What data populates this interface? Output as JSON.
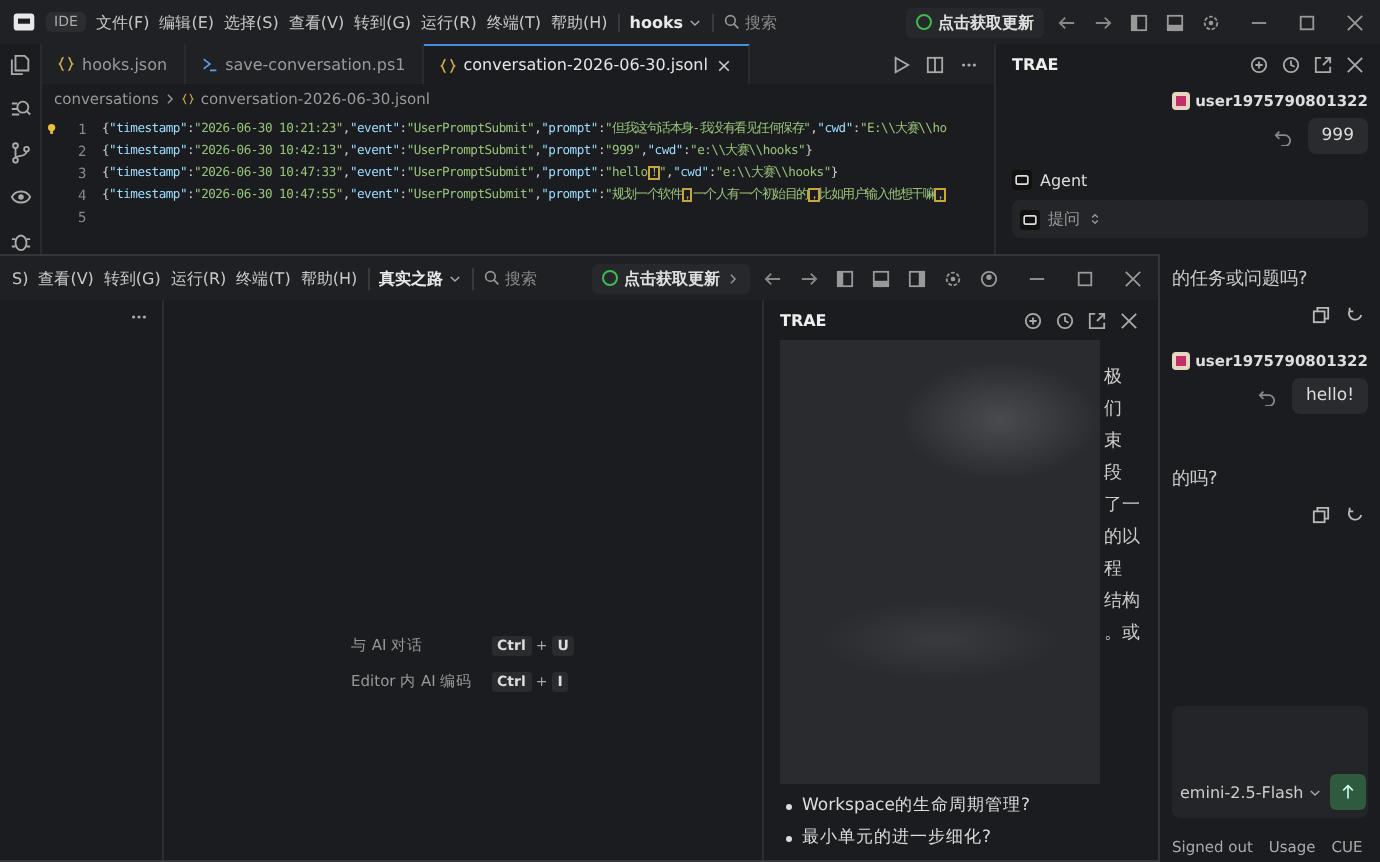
{
  "back_window": {
    "app_label": "IDE",
    "menu": [
      "文件(F)",
      "编辑(E)",
      "选择(S)",
      "查看(V)",
      "转到(G)",
      "运行(R)",
      "终端(T)",
      "帮助(H)"
    ],
    "project": "hooks",
    "search_placeholder": "搜索",
    "update_button": "点击获取更新",
    "tabs": [
      {
        "label": "hooks.json",
        "kind": "json",
        "selected": false
      },
      {
        "label": "save-conversation.ps1",
        "kind": "shell",
        "selected": false
      },
      {
        "label": "conversation-2026-06-30.jsonl",
        "kind": "json",
        "selected": true
      }
    ],
    "breadcrumb": [
      "conversations",
      "conversation-2026-06-30.jsonl"
    ],
    "code_lines": [
      {
        "number": "1",
        "text": "{\"timestamp\":\"2026-06-30 10:21:23\",\"event\":\"UserPromptSubmit\",\"prompt\":\"但我这句话本身-我没有看见任何保存\",\"cwd\":\"E:\\\\大赛\\\\ho"
      },
      {
        "number": "2",
        "text": "{\"timestamp\":\"2026-06-30 10:42:13\",\"event\":\"UserPromptSubmit\",\"prompt\":\"999\",\"cwd\":\"e:\\\\大赛\\\\hooks\"}"
      },
      {
        "number": "3",
        "text": "{\"timestamp\":\"2026-06-30 10:47:33\",\"event\":\"UserPromptSubmit\",\"prompt\":\"hello！\",\"cwd\":\"e:\\\\大赛\\\\hooks\"}"
      },
      {
        "number": "4",
        "text": "{\"timestamp\":\"2026-06-30 10:47:55\",\"event\":\"UserPromptSubmit\",\"prompt\":\"规划一个软件，一个人有一个初始目的，比如用户输入他想干嘛，"
      },
      {
        "number": "5"
      }
    ],
    "chat": {
      "title": "TRAE",
      "user_name": "user1975790801322",
      "first_prompt": "999",
      "agent_label": "Agent",
      "mode_select": "提问",
      "reply_tail": "的任务或问题吗?",
      "second_user_name": "user1975790801322",
      "second_prompt": "hello!",
      "second_reply_tail": "的吗?",
      "model": "emini-2.5-Flash",
      "status": [
        "Signed out",
        "Usage",
        "CUE"
      ]
    }
  },
  "front_window": {
    "menu": [
      "S)",
      "查看(V)",
      "转到(G)",
      "运行(R)",
      "终端(T)",
      "帮助(H)"
    ],
    "project": "真实之路",
    "search_placeholder": "搜索",
    "update_button": "点击获取更新",
    "shortcuts": [
      {
        "label": "与 AI 对话",
        "keys": [
          "Ctrl",
          "U"
        ],
        "separator": "+"
      },
      {
        "label": "Editor 内 AI 编码",
        "keys": [
          "Ctrl",
          "I"
        ],
        "separator": "+"
      }
    ],
    "panel": {
      "title": "TRAE",
      "peek_fragments": [
        "极",
        "们",
        "束",
        "段",
        "了一",
        "的以",
        "程",
        "结构",
        "。或"
      ],
      "bullets": [
        "Workspace的生命周期管理?",
        "最小单元的进一步细化?"
      ]
    }
  }
}
